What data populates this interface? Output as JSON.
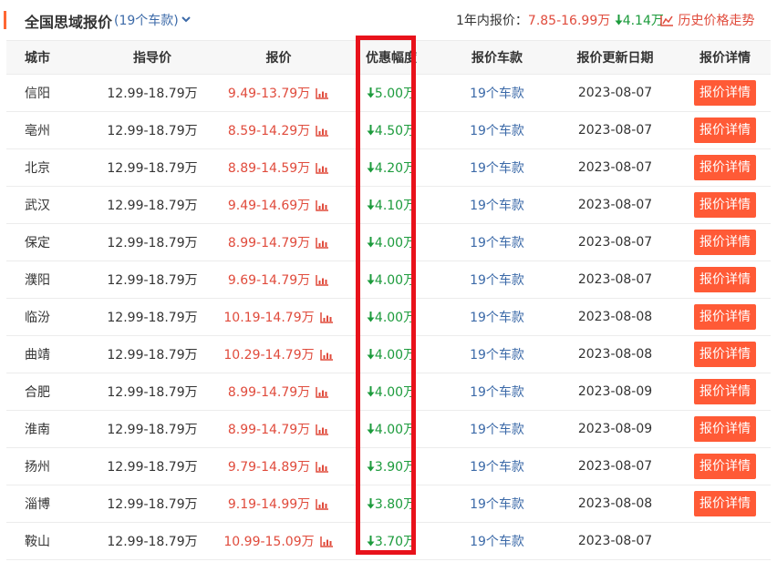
{
  "header": {
    "title": "全国思域报价",
    "model_count": "(19个车款)",
    "range_label": "1年内报价：",
    "range_value": "7.85-16.99万",
    "range_drop": "4.14万",
    "history_label": "历史价格走势"
  },
  "table": {
    "columns": [
      "城市",
      "指导价",
      "报价",
      "优惠幅度",
      "报价车款",
      "报价更新日期",
      "报价详情"
    ],
    "rows": [
      {
        "city": "信阳",
        "guide": "12.99-18.79万",
        "quote": "9.49-13.79万",
        "discount": "5.00万",
        "models": "19个车款",
        "date": "2023-08-07",
        "detail": "报价详情"
      },
      {
        "city": "亳州",
        "guide": "12.99-18.79万",
        "quote": "8.59-14.29万",
        "discount": "4.50万",
        "models": "19个车款",
        "date": "2023-08-07",
        "detail": "报价详情"
      },
      {
        "city": "北京",
        "guide": "12.99-18.79万",
        "quote": "8.89-14.59万",
        "discount": "4.20万",
        "models": "19个车款",
        "date": "2023-08-07",
        "detail": "报价详情"
      },
      {
        "city": "武汉",
        "guide": "12.99-18.79万",
        "quote": "9.49-14.69万",
        "discount": "4.10万",
        "models": "19个车款",
        "date": "2023-08-07",
        "detail": "报价详情"
      },
      {
        "city": "保定",
        "guide": "12.99-18.79万",
        "quote": "8.99-14.79万",
        "discount": "4.00万",
        "models": "19个车款",
        "date": "2023-08-07",
        "detail": "报价详情"
      },
      {
        "city": "濮阳",
        "guide": "12.99-18.79万",
        "quote": "9.69-14.79万",
        "discount": "4.00万",
        "models": "19个车款",
        "date": "2023-08-07",
        "detail": "报价详情"
      },
      {
        "city": "临汾",
        "guide": "12.99-18.79万",
        "quote": "10.19-14.79万",
        "discount": "4.00万",
        "models": "19个车款",
        "date": "2023-08-08",
        "detail": "报价详情"
      },
      {
        "city": "曲靖",
        "guide": "12.99-18.79万",
        "quote": "10.29-14.79万",
        "discount": "4.00万",
        "models": "19个车款",
        "date": "2023-08-08",
        "detail": "报价详情"
      },
      {
        "city": "合肥",
        "guide": "12.99-18.79万",
        "quote": "8.99-14.79万",
        "discount": "4.00万",
        "models": "19个车款",
        "date": "2023-08-09",
        "detail": "报价详情"
      },
      {
        "city": "淮南",
        "guide": "12.99-18.79万",
        "quote": "8.99-14.79万",
        "discount": "4.00万",
        "models": "19个车款",
        "date": "2023-08-09",
        "detail": "报价详情"
      },
      {
        "city": "扬州",
        "guide": "12.99-18.79万",
        "quote": "9.79-14.89万",
        "discount": "3.90万",
        "models": "19个车款",
        "date": "2023-08-07",
        "detail": "报价详情"
      },
      {
        "city": "淄博",
        "guide": "12.99-18.79万",
        "quote": "9.19-14.99万",
        "discount": "3.80万",
        "models": "19个车款",
        "date": "2023-08-08",
        "detail": "报价详情"
      },
      {
        "city": "鞍山",
        "guide": "12.99-18.79万",
        "quote": "10.99-15.09万",
        "discount": "3.70万",
        "models": "19个车款",
        "date": "2023-08-07",
        "detail": ""
      }
    ]
  },
  "colors": {
    "accent": "#ff6633",
    "price_red": "#e04b3c",
    "discount_green": "#1c9b3c",
    "link_blue": "#3c6aa8",
    "button_orange": "#ff5a36",
    "highlight_red": "#e8121b"
  },
  "icons": {
    "chart": "chart-icon",
    "down_arrow": "arrow-down-icon",
    "chevron": "chevron-down-icon"
  }
}
